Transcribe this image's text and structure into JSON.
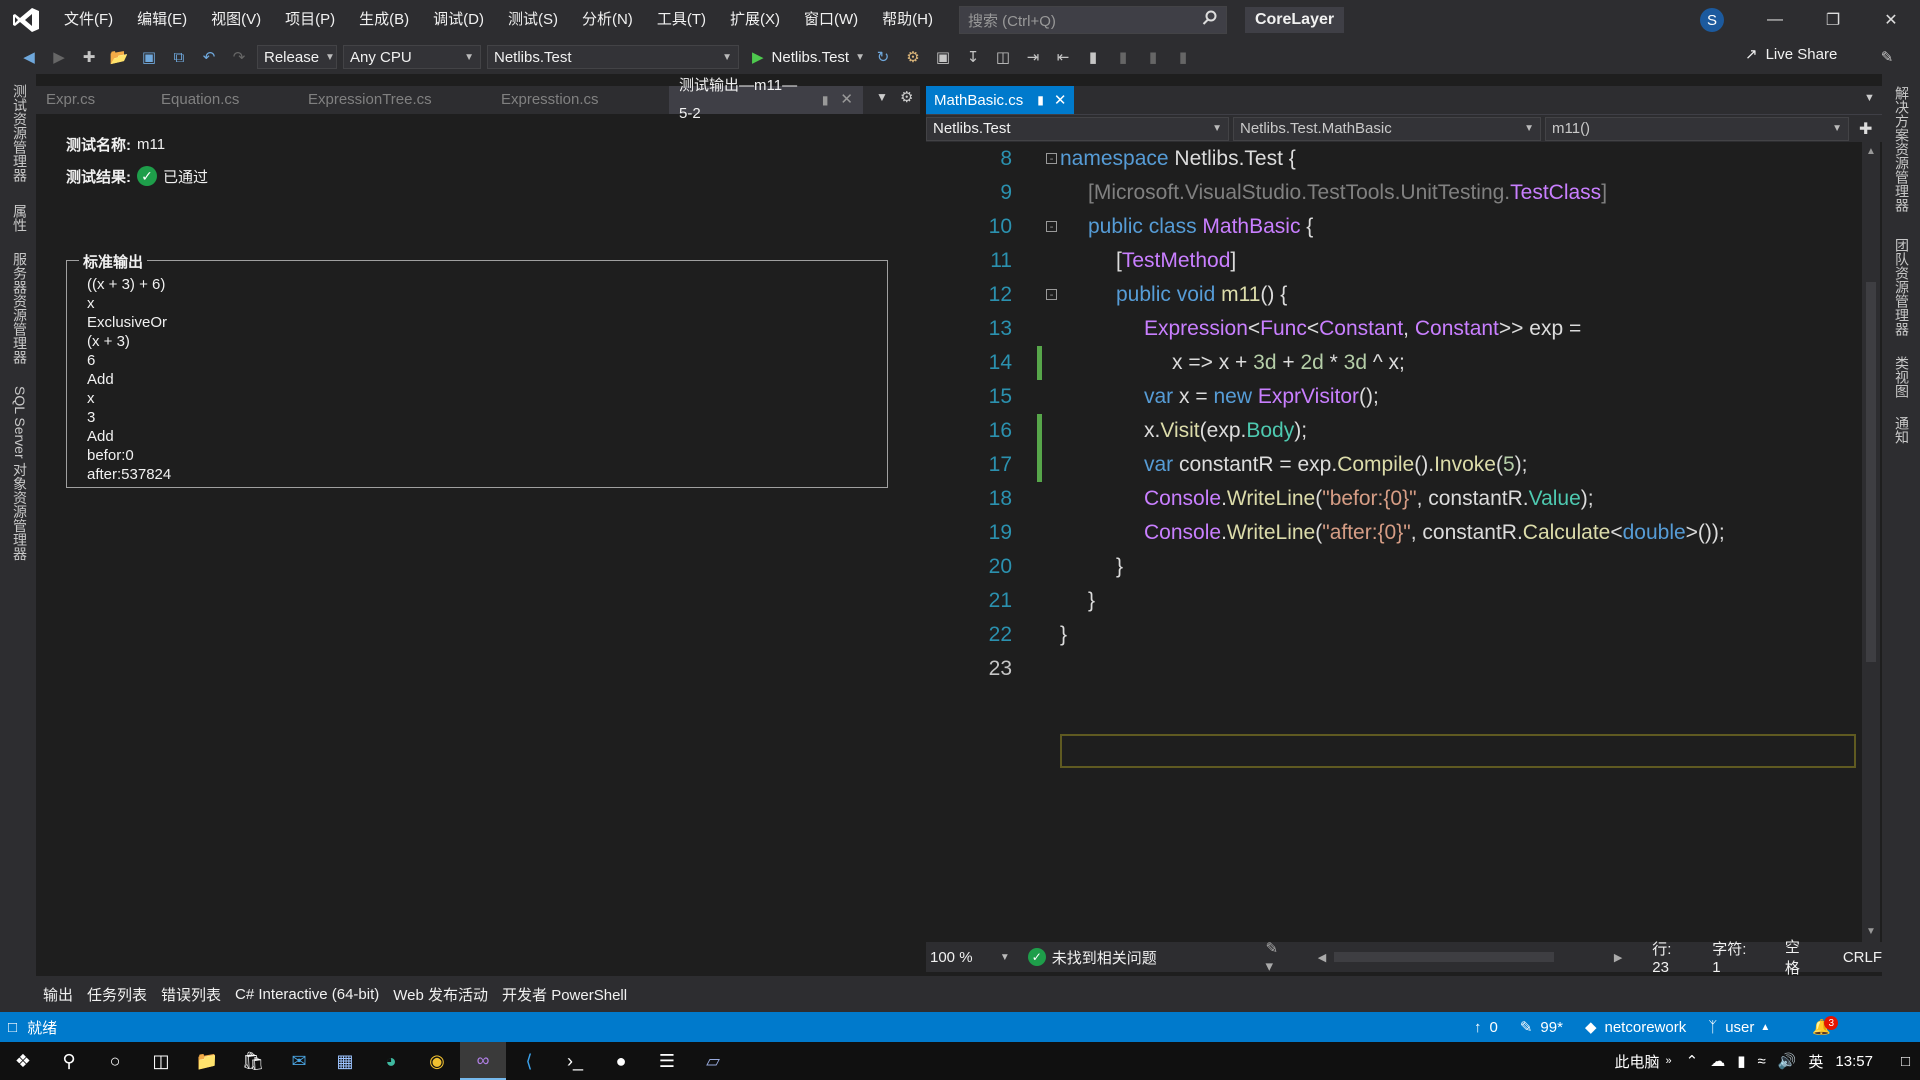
{
  "title_bar": {
    "menu": [
      "文件(F)",
      "编辑(E)",
      "视图(V)",
      "项目(P)",
      "生成(B)",
      "调试(D)",
      "测试(S)",
      "分析(N)",
      "工具(T)",
      "扩展(X)",
      "窗口(W)",
      "帮助(H)"
    ],
    "search_placeholder": "搜索 (Ctrl+Q)",
    "solution_name": "CoreLayer",
    "user_initial": "S"
  },
  "toolbar": {
    "configuration": "Release",
    "platform": "Any CPU",
    "startup_project": "Netlibs.Test",
    "run_target": "Netlibs.Test",
    "live_share": "Live Share"
  },
  "left_strip_tabs": [
    "测试资源管理器",
    "属性",
    "服务器资源管理器",
    "SQL Server 对象资源管理器"
  ],
  "right_strip_tabs": [
    "解决方案资源管理器",
    "团队资源管理器",
    "类视图",
    "通知"
  ],
  "left_doc": {
    "tabs": [
      "Expr.cs",
      "Equation.cs",
      "ExpressionTree.cs",
      "Expresstion.cs",
      "测试输出—m11—5-2"
    ],
    "test_name_label": "测试名称:",
    "test_name": "m11",
    "test_result_label": "测试结果:",
    "test_result": "已通过",
    "stdout_title": "标准输出",
    "stdout_lines": [
      "((x + 3) + 6)",
      "x",
      "ExclusiveOr",
      "(x + 3)",
      "6",
      "Add",
      "x",
      "3",
      "Add",
      "befor:0",
      "after:537824"
    ]
  },
  "editor": {
    "active_tab": "MathBasic.cs",
    "nav_project": "Netlibs.Test",
    "nav_class": "Netlibs.Test.MathBasic",
    "nav_member": "m11()",
    "line_numbers": [
      "8",
      "9",
      "10",
      "11",
      "12",
      "13",
      "14",
      "15",
      "16",
      "17",
      "18",
      "19",
      "20",
      "21",
      "22",
      "23"
    ],
    "zoom": "100 %",
    "issues": "未找到相关问题",
    "row": "行: 23",
    "col": "字符: 1",
    "whitespace": "空格",
    "line_ending": "CRLF"
  },
  "bottom_tabs": [
    "输出",
    "任务列表",
    "错误列表",
    "C# Interactive (64-bit)",
    "Web 发布活动",
    "开发者 PowerShell"
  ],
  "status_bar": {
    "state": "就绪",
    "up_count": "0",
    "edit_count": "99*",
    "repo": "netcorework",
    "branch": "user",
    "notifications": "3"
  },
  "taskbar": {
    "this_pc": "此电脑",
    "ime": "英",
    "time": "13:57"
  },
  "colors": {
    "accent": "#007acc",
    "pass": "#1e9e4a",
    "line_number": "#2b91af"
  }
}
